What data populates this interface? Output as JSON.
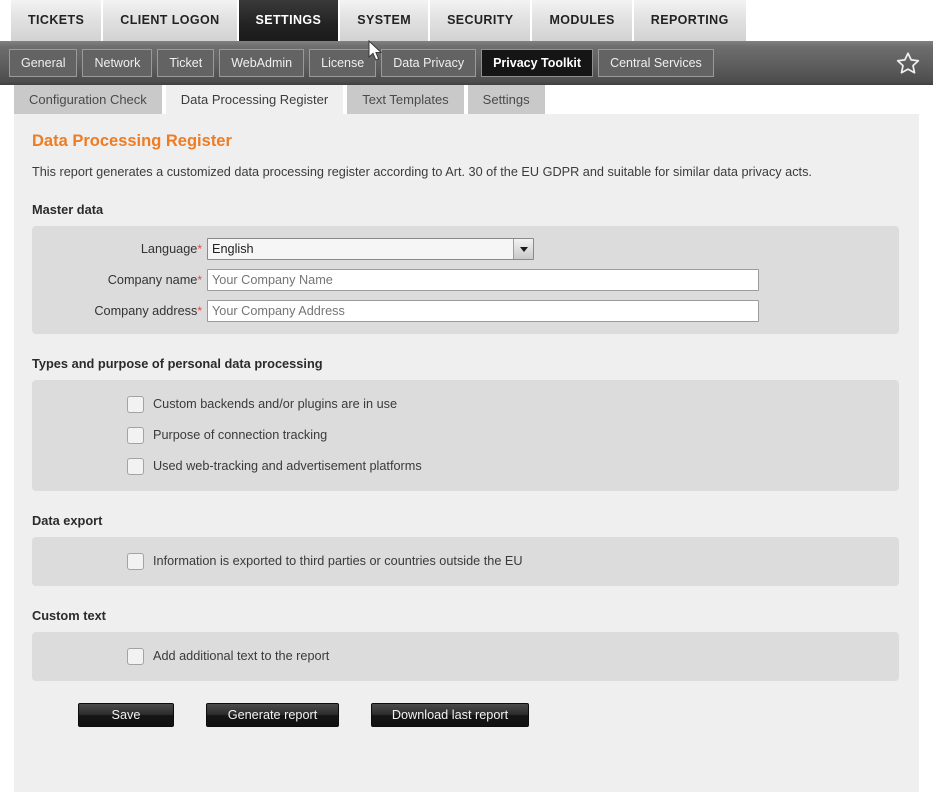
{
  "main_nav": {
    "items": [
      {
        "label": "TICKETS",
        "active": false
      },
      {
        "label": "CLIENT LOGON",
        "active": false
      },
      {
        "label": "SETTINGS",
        "active": true
      },
      {
        "label": "SYSTEM",
        "active": false
      },
      {
        "label": "SECURITY",
        "active": false
      },
      {
        "label": "MODULES",
        "active": false
      },
      {
        "label": "REPORTING",
        "active": false
      }
    ]
  },
  "sub_nav": {
    "items": [
      {
        "label": "General",
        "active": false
      },
      {
        "label": "Network",
        "active": false
      },
      {
        "label": "Ticket",
        "active": false
      },
      {
        "label": "WebAdmin",
        "active": false
      },
      {
        "label": "License",
        "active": false
      },
      {
        "label": "Data Privacy",
        "active": false
      },
      {
        "label": "Privacy Toolkit",
        "active": true
      },
      {
        "label": "Central Services",
        "active": false
      }
    ],
    "favorite_icon": "star-outline-icon"
  },
  "inner_tabs": [
    {
      "label": "Configuration Check",
      "active": false
    },
    {
      "label": "Data Processing Register",
      "active": true
    },
    {
      "label": "Text Templates",
      "active": false
    },
    {
      "label": "Settings",
      "active": false
    }
  ],
  "page": {
    "title": "Data Processing Register",
    "description": "This report generates a customized data processing register according to Art. 30 of the EU GDPR and suitable for similar data privacy acts.",
    "title_color": "#ef7c22"
  },
  "sections": {
    "master_data": {
      "heading": "Master data",
      "fields": {
        "language": {
          "label": "Language",
          "required_marker": "*",
          "value": "English",
          "options": [
            "English"
          ]
        },
        "company_name": {
          "label": "Company name",
          "required_marker": "*",
          "value": "",
          "placeholder": "Your Company Name"
        },
        "company_address": {
          "label": "Company address",
          "required_marker": "*",
          "value": "",
          "placeholder": "Your Company Address"
        }
      }
    },
    "types_purpose": {
      "heading": "Types and purpose of personal data processing",
      "checkboxes": [
        {
          "label": "Custom backends and/or plugins are in use",
          "checked": false
        },
        {
          "label": "Purpose of connection tracking",
          "checked": false
        },
        {
          "label": "Used web-tracking and advertisement platforms",
          "checked": false
        }
      ]
    },
    "data_export": {
      "heading": "Data export",
      "checkboxes": [
        {
          "label": "Information is exported to third parties or countries outside the EU",
          "checked": false
        }
      ]
    },
    "custom_text": {
      "heading": "Custom text",
      "checkboxes": [
        {
          "label": "Add additional text to the report",
          "checked": false
        }
      ]
    }
  },
  "buttons": {
    "save": "Save",
    "generate": "Generate report",
    "download": "Download last report"
  }
}
